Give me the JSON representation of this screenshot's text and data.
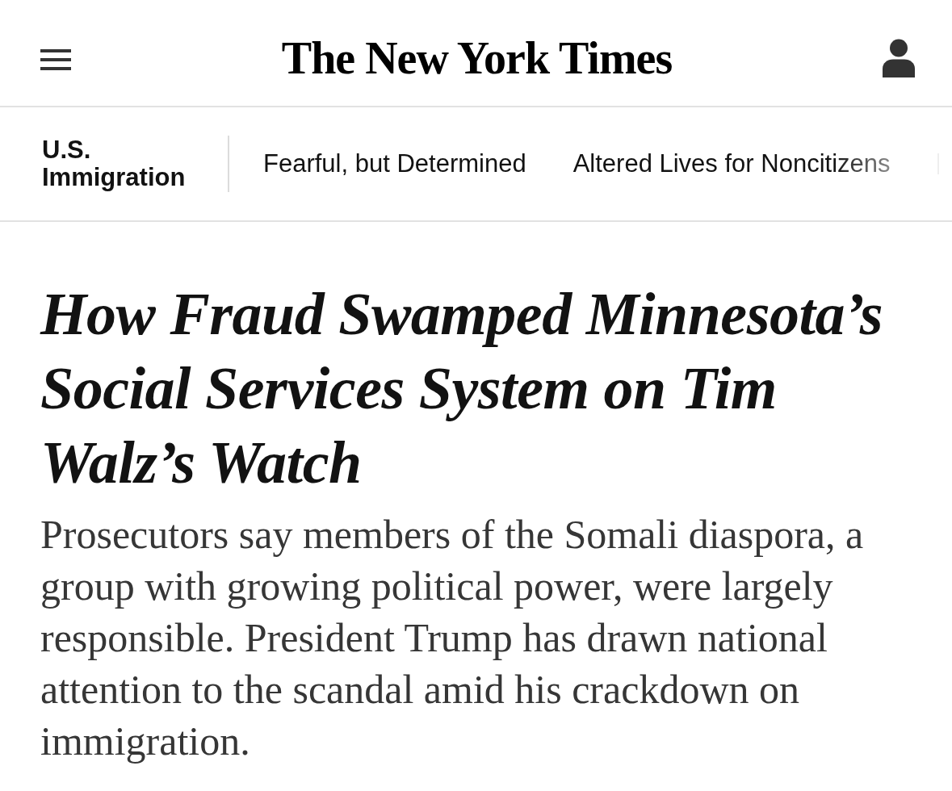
{
  "header": {
    "logo": "The New York Times"
  },
  "section_nav": {
    "section": "U.S. Immigration",
    "links": [
      {
        "label": "Fearful, but Determined"
      },
      {
        "label": "Altered Lives for Noncitizens"
      }
    ]
  },
  "article": {
    "headline": "How Fraud Swamped Minnesota’s Social Services System on Tim Walz’s Watch",
    "summary": "Prosecutors say members of the Somali diaspora, a group with growing political power, were largely responsible. President Trump has drawn national attention to the scandal amid his crackdown on immigration."
  }
}
